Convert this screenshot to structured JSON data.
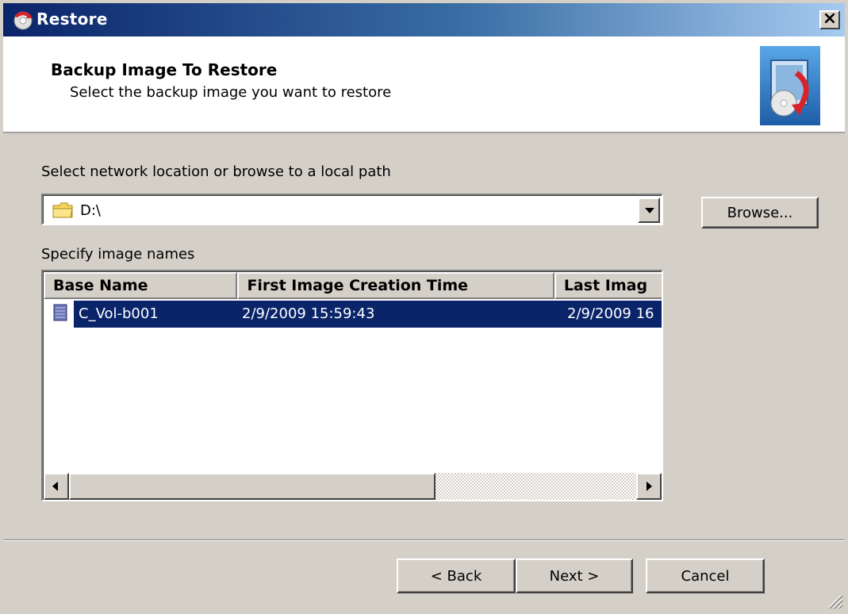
{
  "window": {
    "title": "Restore",
    "close_label": "×"
  },
  "header": {
    "title": "Backup Image To Restore",
    "subtitle": "Select the backup image you want to restore"
  },
  "location": {
    "label": "Select network location or browse to a local path",
    "value": "D:\\",
    "browse_label": "Browse..."
  },
  "images": {
    "label": "Specify image names",
    "columns": [
      "Base Name",
      "First Image Creation Time",
      "Last Imag"
    ],
    "rows": [
      {
        "base_name": "C_Vol-b001",
        "first_time": "2/9/2009 15:59:43",
        "last_time": "2/9/2009 16",
        "selected": true
      }
    ]
  },
  "footer": {
    "back_label": "< Back",
    "next_label": "Next >",
    "cancel_label": "Cancel"
  },
  "colors": {
    "selection": "#0a246a",
    "face": "#d4d0c8"
  }
}
